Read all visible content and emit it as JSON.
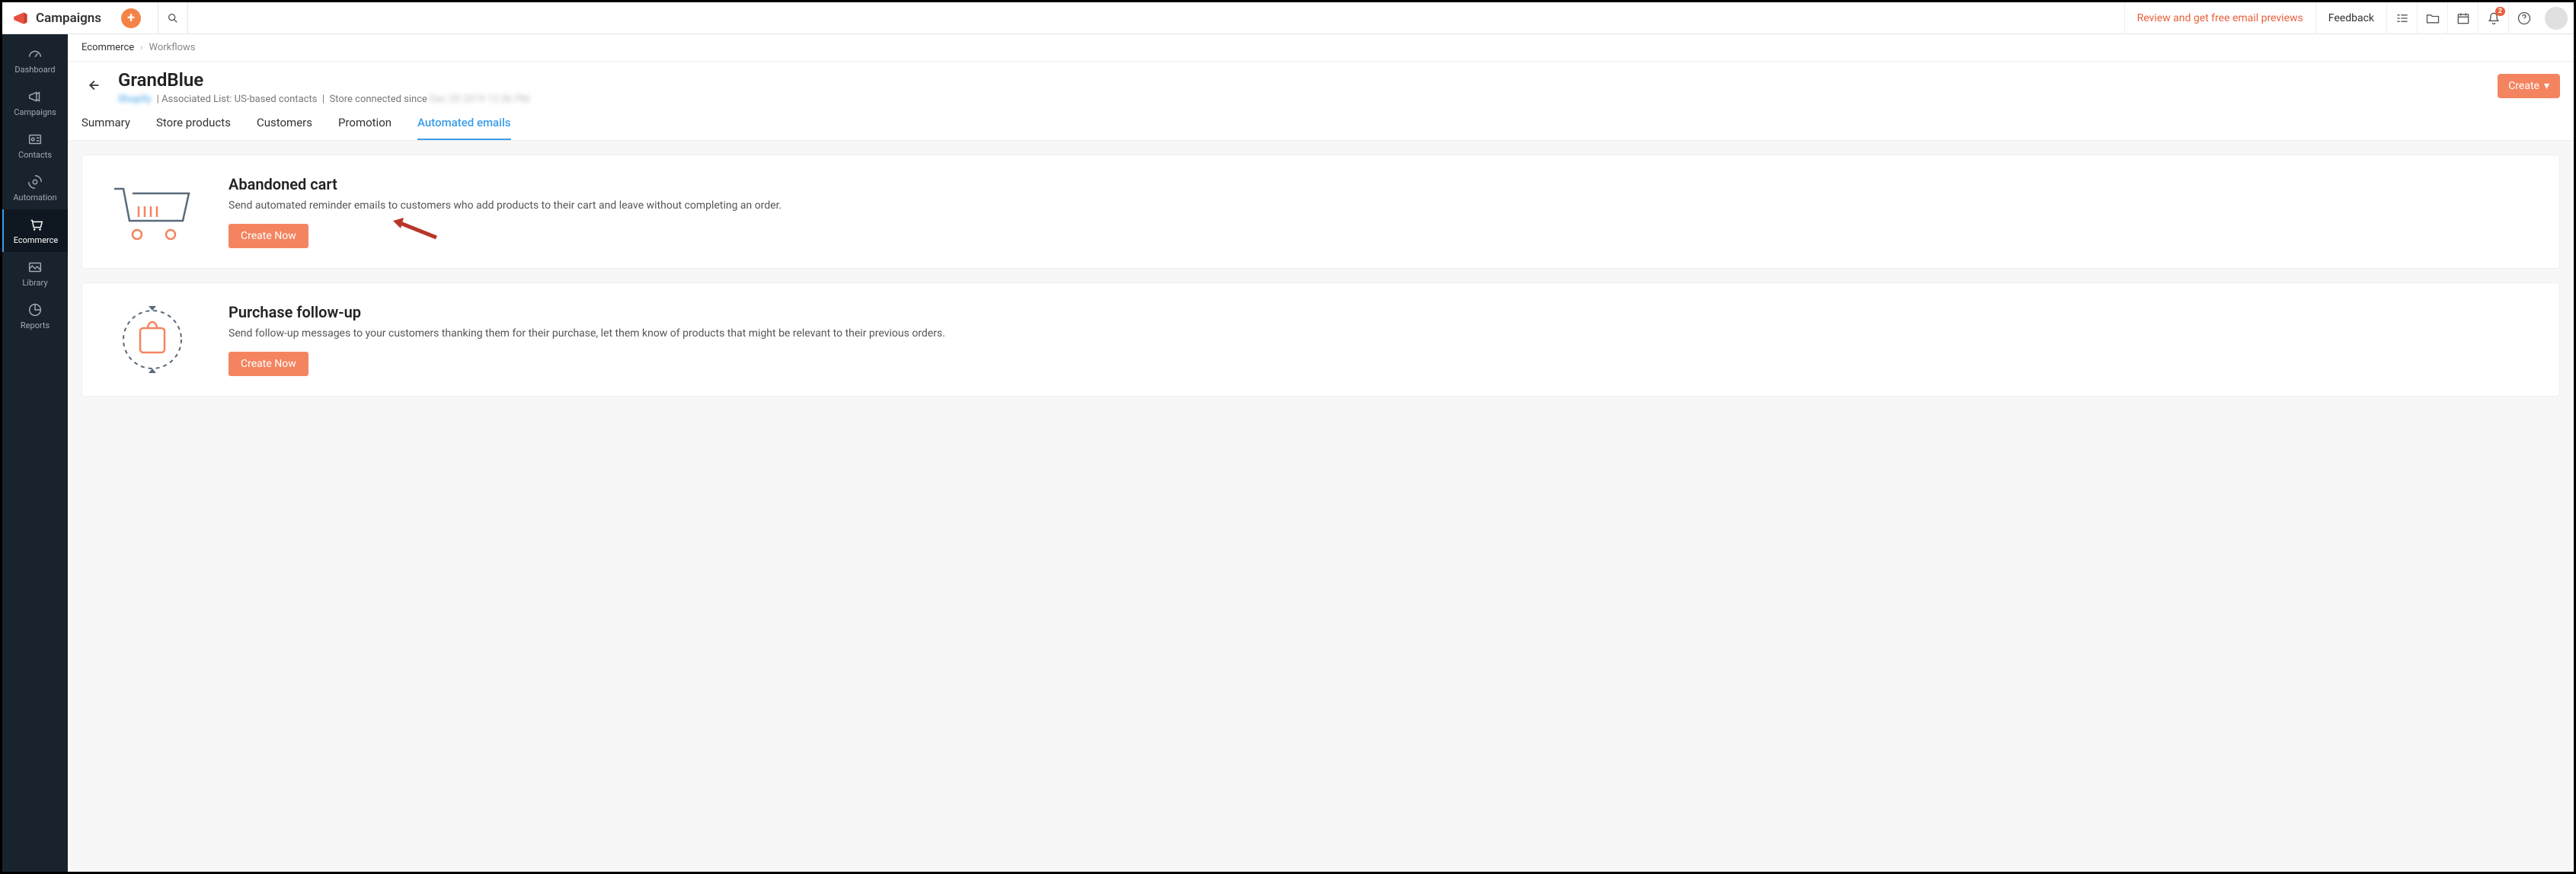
{
  "topbar": {
    "app_name": "Campaigns",
    "promo_link": "Review and get free email previews",
    "feedback": "Feedback",
    "notification_count": "2"
  },
  "sidebar": {
    "items": [
      {
        "label": "Dashboard"
      },
      {
        "label": "Campaigns"
      },
      {
        "label": "Contacts"
      },
      {
        "label": "Automation"
      },
      {
        "label": "Ecommerce"
      },
      {
        "label": "Library"
      },
      {
        "label": "Reports"
      }
    ]
  },
  "breadcrumb": {
    "root": "Ecommerce",
    "current": "Workflows"
  },
  "header": {
    "store_name": "GrandBlue",
    "platform": "Shopify",
    "associated_list_label": "Associated List:",
    "associated_list_value": "US-based contacts",
    "connected_since_label": "Store connected since",
    "connected_since_value": "Dec 20 2019 12:36 PM",
    "create_button": "Create"
  },
  "tabs": [
    {
      "label": "Summary"
    },
    {
      "label": "Store products"
    },
    {
      "label": "Customers"
    },
    {
      "label": "Promotion"
    },
    {
      "label": "Automated emails"
    }
  ],
  "workflows": [
    {
      "title": "Abandoned cart",
      "desc": "Send automated reminder emails to customers who add products to their cart and leave without completing an order.",
      "button": "Create Now"
    },
    {
      "title": "Purchase follow-up",
      "desc": "Send follow-up messages to your customers thanking them for their purchase, let them know of products that might be relevant to their previous orders.",
      "button": "Create Now"
    }
  ]
}
